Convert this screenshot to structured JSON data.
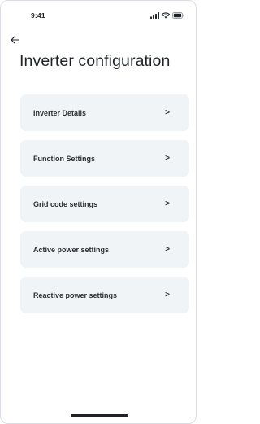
{
  "status_bar": {
    "time": "9:41",
    "icons": [
      "signal-icon",
      "wifi-icon",
      "battery-icon"
    ]
  },
  "header": {
    "back_icon": "arrow-left-icon",
    "title": "Inverter configuration"
  },
  "menu": {
    "items": [
      {
        "label": "Inverter Details",
        "chevron": ">"
      },
      {
        "label": "Function Settings",
        "chevron": ">"
      },
      {
        "label": "Grid code settings",
        "chevron": ">"
      },
      {
        "label": "Active power settings",
        "chevron": ">"
      },
      {
        "label": "Reactive power settings",
        "chevron": ">"
      }
    ]
  },
  "colors": {
    "card_background": "#f1f4f7",
    "text": "#1f2329",
    "frame_border": "#d9dde2"
  }
}
